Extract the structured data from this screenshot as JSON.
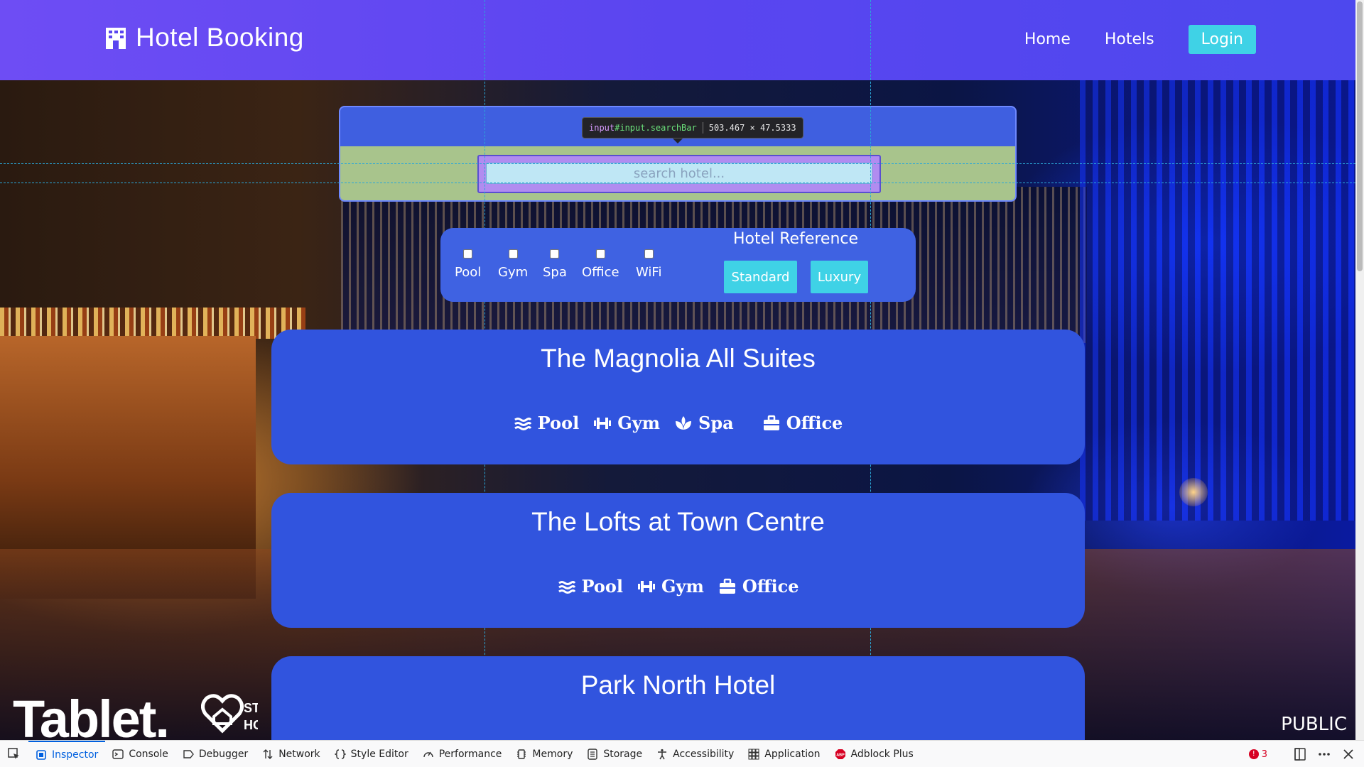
{
  "header": {
    "brand": "Hotel Booking",
    "nav": [
      "Home",
      "Hotels"
    ],
    "login": "Login"
  },
  "search": {
    "placeholder": "search hotel...",
    "tooltip_tag": "input",
    "tooltip_selector": "#input.searchBar",
    "tooltip_size": "503.467 × 47.5333"
  },
  "filters": {
    "amenities": [
      "Pool",
      "Gym",
      "Spa",
      "Office",
      "WiFi"
    ],
    "reference_title": "Hotel Reference",
    "reference_options": [
      "Standard",
      "Luxury"
    ]
  },
  "hotels": [
    {
      "name": "The Magnolia All Suites",
      "features": [
        "Pool",
        "Gym",
        "Spa",
        "Office"
      ]
    },
    {
      "name": "The Lofts at Town Centre",
      "features": [
        "Pool",
        "Gym",
        "Office"
      ]
    },
    {
      "name": "Park North Hotel",
      "features": []
    }
  ],
  "background": {
    "watermark": "Tablet.",
    "watermark_cut": "ST HO",
    "badge": "PUBLIC"
  },
  "devtools": {
    "tabs": [
      "Inspector",
      "Console",
      "Debugger",
      "Network",
      "Style Editor",
      "Performance",
      "Memory",
      "Storage",
      "Accessibility",
      "Application",
      "Adblock Plus"
    ],
    "active_tab": "Inspector",
    "error_count": "3"
  },
  "colors": {
    "header_start": "#6e4df4",
    "header_end": "#4d48ee",
    "accent_button": "#3fd2e6",
    "card": "#3154de",
    "devtools_active": "#0060df"
  }
}
